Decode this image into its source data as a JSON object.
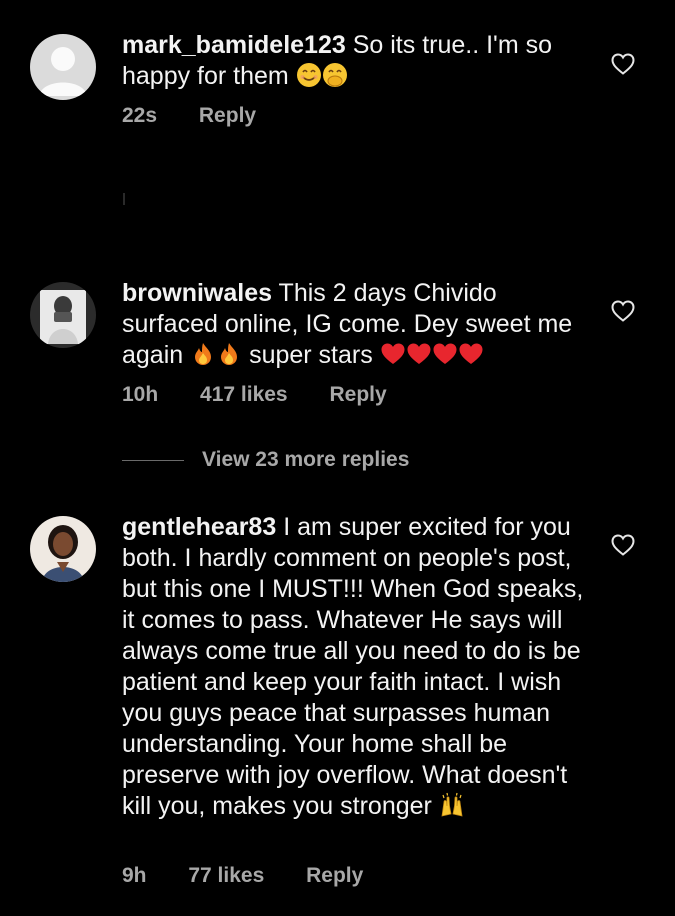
{
  "comments": [
    {
      "username": "mark_bamidele123",
      "text": "So its true.. I'm so happy for them",
      "emojis": [
        "smiling-face-icon",
        "face-with-hand-over-mouth-icon"
      ],
      "time": "22s",
      "likes": "",
      "reply": "Reply"
    },
    {
      "username": "browniwales",
      "text_part1": "This 2 days Chivido surfaced online, IG come. Dey sweet me again",
      "text_part2": "super stars",
      "emojis": [
        "fire-icon",
        "fire-icon",
        "red-heart-icon",
        "red-heart-icon",
        "red-heart-icon",
        "red-heart-icon"
      ],
      "time": "10h",
      "likes": "417 likes",
      "reply": "Reply",
      "view_replies": "View 23 more replies"
    },
    {
      "username": "gentlehear83",
      "text": "I am super excited for you both. I hardly comment on people's post, but this one I MUST!!! When God speaks, it comes to pass. Whatever He says will always come true all you need to do is be patient and keep your faith intact. I wish you guys peace that surpasses human understanding. Your home shall be preserve  with  joy overflow. What doesn't kill you, makes you stronger",
      "emojis": [
        "raising-hands-icon"
      ],
      "time": "9h",
      "likes": "77 likes",
      "reply": "Reply"
    }
  ],
  "colors": {
    "background": "#000000",
    "text": "#f3f3f3",
    "meta": "#a8a8a8",
    "heart_outline": "#e6e6e6",
    "emoji_heart": "#e8262e",
    "fire": "#f07a1a"
  }
}
